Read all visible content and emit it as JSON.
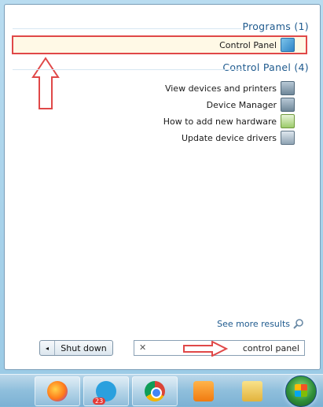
{
  "programs": {
    "header": "Programs (1)",
    "items": [
      {
        "label": "Control Panel",
        "icon": "control-panel-icon"
      }
    ]
  },
  "control_panel": {
    "header": "Control Panel (4)",
    "items": [
      {
        "label": "View devices and printers",
        "icon": "devices-printers-icon"
      },
      {
        "label": "Device Manager",
        "icon": "device-manager-icon"
      },
      {
        "label": "How to add new hardware",
        "icon": "add-hardware-icon"
      },
      {
        "label": "Update device drivers",
        "icon": "update-drivers-icon"
      }
    ]
  },
  "see_more": {
    "label": "See more results",
    "icon": "search-icon"
  },
  "search": {
    "value": "control panel",
    "clear_icon": "close-icon"
  },
  "shutdown": {
    "label": "Shut down",
    "arrow": "◂"
  },
  "taskbar": {
    "badge": "23",
    "items": [
      "firefox",
      "telegram",
      "chrome",
      "media-player",
      "file-explorer"
    ]
  },
  "colors": {
    "annotation_red": "#e04848",
    "header_blue": "#1e5a8e"
  }
}
